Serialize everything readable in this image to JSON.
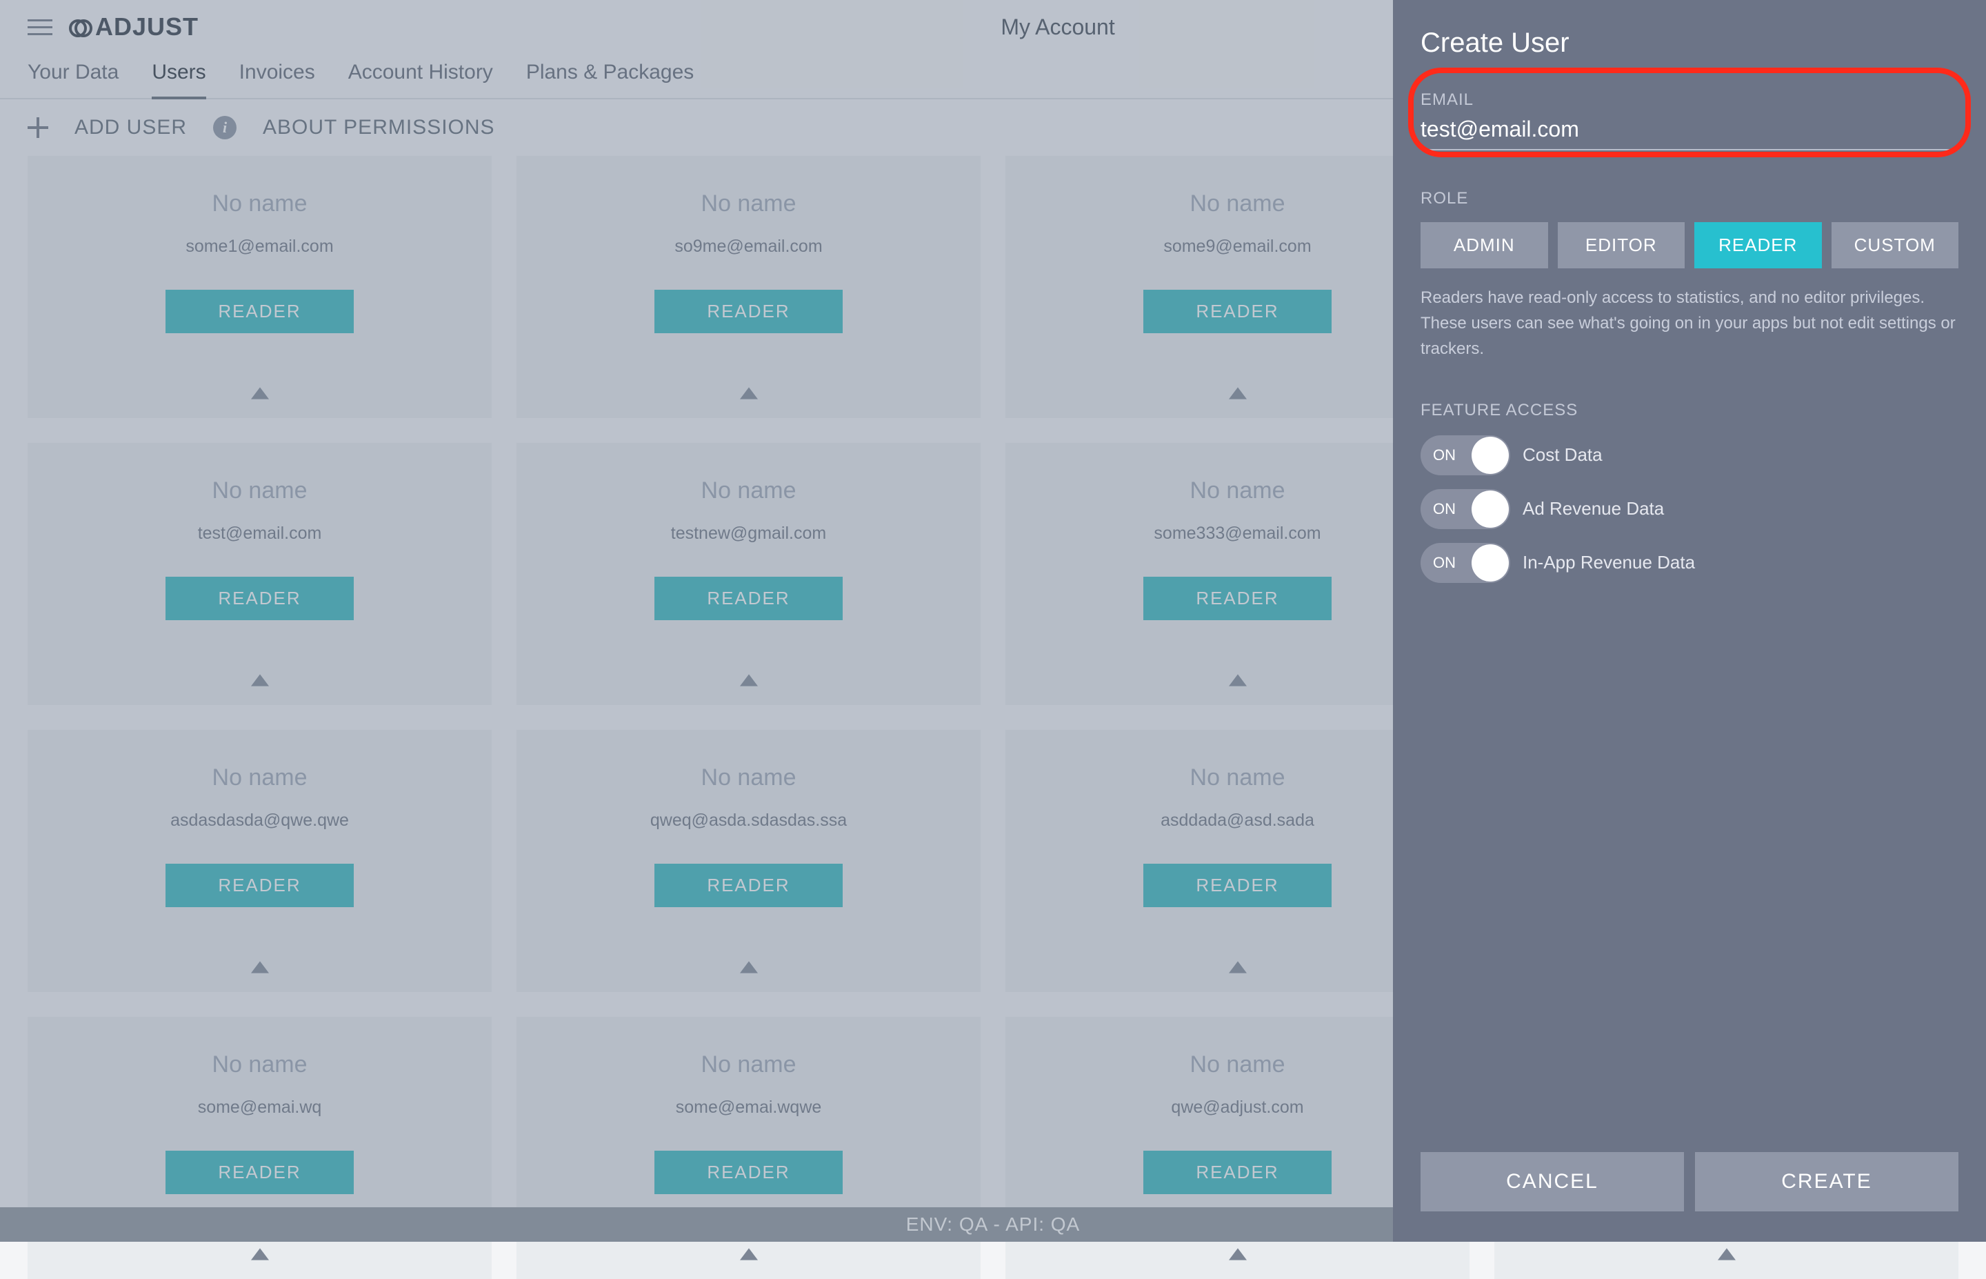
{
  "header": {
    "brand": "ADJUST",
    "page_title": "My Account"
  },
  "nav": {
    "items": [
      "Your Data",
      "Users",
      "Invoices",
      "Account History",
      "Plans & Packages"
    ],
    "active_index": 1
  },
  "subbar": {
    "add_user": "ADD USER",
    "about_permissions": "ABOUT PERMISSIONS"
  },
  "users": [
    {
      "name": "No name",
      "email": "some1@email.com",
      "role": "READER"
    },
    {
      "name": "No name",
      "email": "so9me@email.com",
      "role": "READER"
    },
    {
      "name": "No name",
      "email": "some9@email.com",
      "role": "READER"
    },
    {
      "name": "No name",
      "email": "",
      "role": "READER"
    },
    {
      "name": "No name",
      "email": "test@email.com",
      "role": "READER"
    },
    {
      "name": "No name",
      "email": "testnew@gmail.com",
      "role": "READER"
    },
    {
      "name": "No name",
      "email": "some333@email.com",
      "role": "READER"
    },
    {
      "name": "No name",
      "email": "",
      "role": "READER"
    },
    {
      "name": "No name",
      "email": "asdasdasda@qwe.qwe",
      "role": "READER"
    },
    {
      "name": "No name",
      "email": "qweq@asda.sdasdas.ssa",
      "role": "READER"
    },
    {
      "name": "No name",
      "email": "asddada@asd.sada",
      "role": "READER"
    },
    {
      "name": "No name",
      "email": "",
      "role": "READER"
    },
    {
      "name": "No name",
      "email": "some@emai.wq",
      "role": "READER"
    },
    {
      "name": "No name",
      "email": "some@emai.wqwe",
      "role": "READER"
    },
    {
      "name": "No name",
      "email": "qwe@adjust.com",
      "role": "READER"
    },
    {
      "name": "No name",
      "email": "",
      "role": "READER"
    }
  ],
  "env_bar": "ENV: QA - API: QA",
  "panel": {
    "title": "Create User",
    "email_label": "EMAIL",
    "email_value": "test@email.com",
    "role_label": "ROLE",
    "roles": [
      "ADMIN",
      "EDITOR",
      "READER",
      "CUSTOM"
    ],
    "role_active_index": 2,
    "role_description": "Readers have read-only access to statistics, and no editor privileges. These users can see what's going on in your apps but not edit settings or trackers.",
    "feature_label": "FEATURE ACCESS",
    "toggle_on_label": "ON",
    "features": [
      {
        "label": "Cost Data",
        "on": true
      },
      {
        "label": "Ad Revenue Data",
        "on": true
      },
      {
        "label": "In-App Revenue Data",
        "on": true
      }
    ],
    "cancel": "CANCEL",
    "create": "CREATE"
  }
}
